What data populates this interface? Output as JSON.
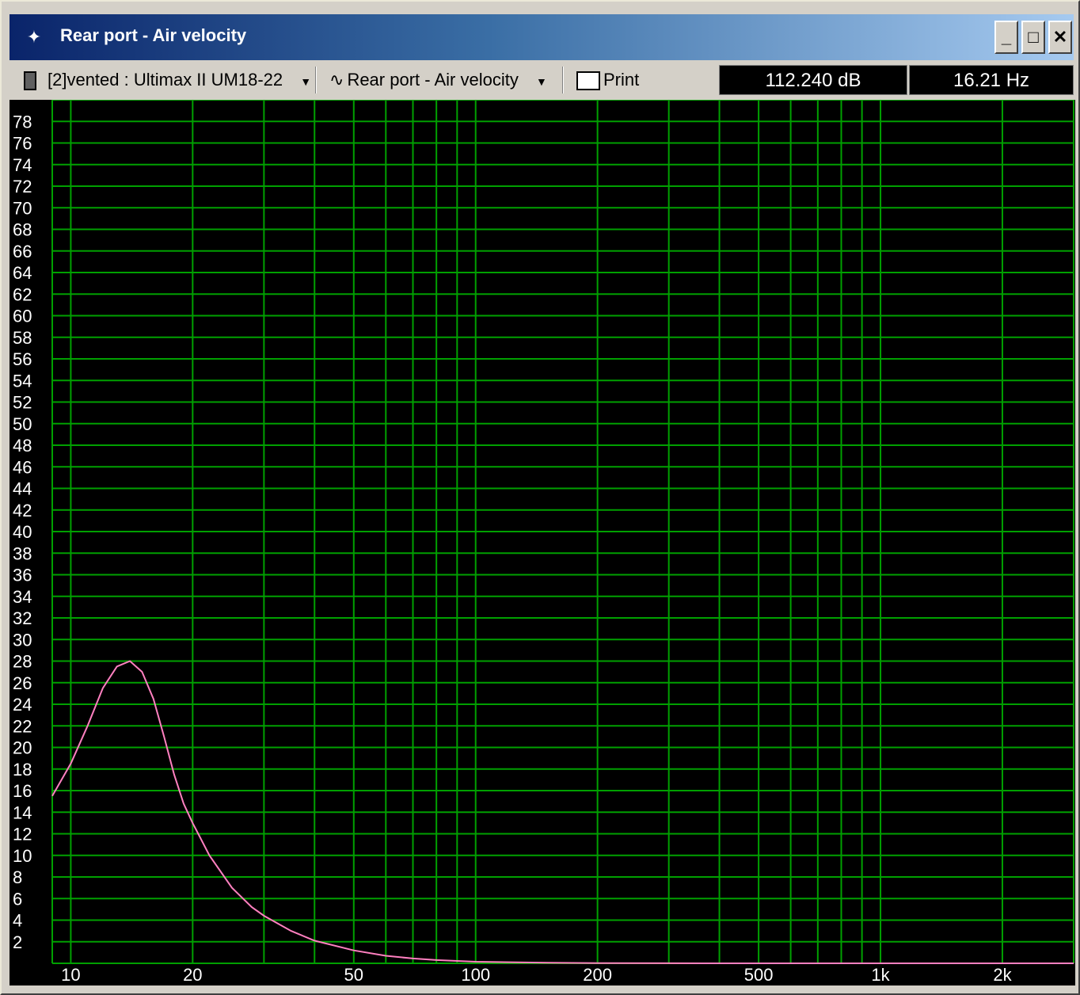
{
  "window": {
    "title": "Rear port - Air velocity",
    "minimize_glyph": "_",
    "maximize_glyph": "□",
    "close_glyph": "✕"
  },
  "toolbar": {
    "driver_select": "[2]vented : Ultimax II UM18-22",
    "graph_select": "Rear port - Air velocity",
    "print_label": "Print",
    "level_readout": "112.240 dB",
    "freq_readout": "16.21 Hz"
  },
  "colors": {
    "grid": "#00a000",
    "curve": "#ff80c0",
    "plot_bg": "#000000",
    "axis_text": "#ffffff"
  },
  "chart_data": {
    "type": "line",
    "x_scale": "log",
    "xlim": [
      9,
      3000
    ],
    "ylim": [
      0,
      80
    ],
    "x_ticks": [
      {
        "value": 10,
        "label": "10"
      },
      {
        "value": 20,
        "label": "20"
      },
      {
        "value": 50,
        "label": "50"
      },
      {
        "value": 100,
        "label": "100"
      },
      {
        "value": 200,
        "label": "200"
      },
      {
        "value": 500,
        "label": "500"
      },
      {
        "value": 1000,
        "label": "1k"
      },
      {
        "value": 2000,
        "label": "2k"
      }
    ],
    "y_ticks": [
      2,
      4,
      6,
      8,
      10,
      12,
      14,
      16,
      18,
      20,
      22,
      24,
      26,
      28,
      30,
      32,
      34,
      36,
      38,
      40,
      42,
      44,
      46,
      48,
      50,
      52,
      54,
      56,
      58,
      60,
      62,
      64,
      66,
      68,
      70,
      72,
      74,
      76,
      78
    ],
    "grid": true,
    "series": [
      {
        "x": [
          9,
          10,
          11,
          12,
          13,
          14,
          15,
          16,
          17,
          18,
          19,
          20,
          22,
          25,
          28,
          30,
          35,
          40,
          50,
          60,
          70,
          80,
          100,
          150,
          200,
          300,
          500,
          1000,
          2000,
          3000
        ],
        "y": [
          15.5,
          18.5,
          22,
          25.5,
          27.5,
          28,
          27,
          24.5,
          21,
          17.5,
          14.8,
          13,
          10,
          7,
          5.2,
          4.4,
          3,
          2.1,
          1.2,
          0.7,
          0.45,
          0.3,
          0.15,
          0.05,
          0.02,
          0.01,
          0,
          0,
          0,
          0
        ]
      }
    ]
  }
}
